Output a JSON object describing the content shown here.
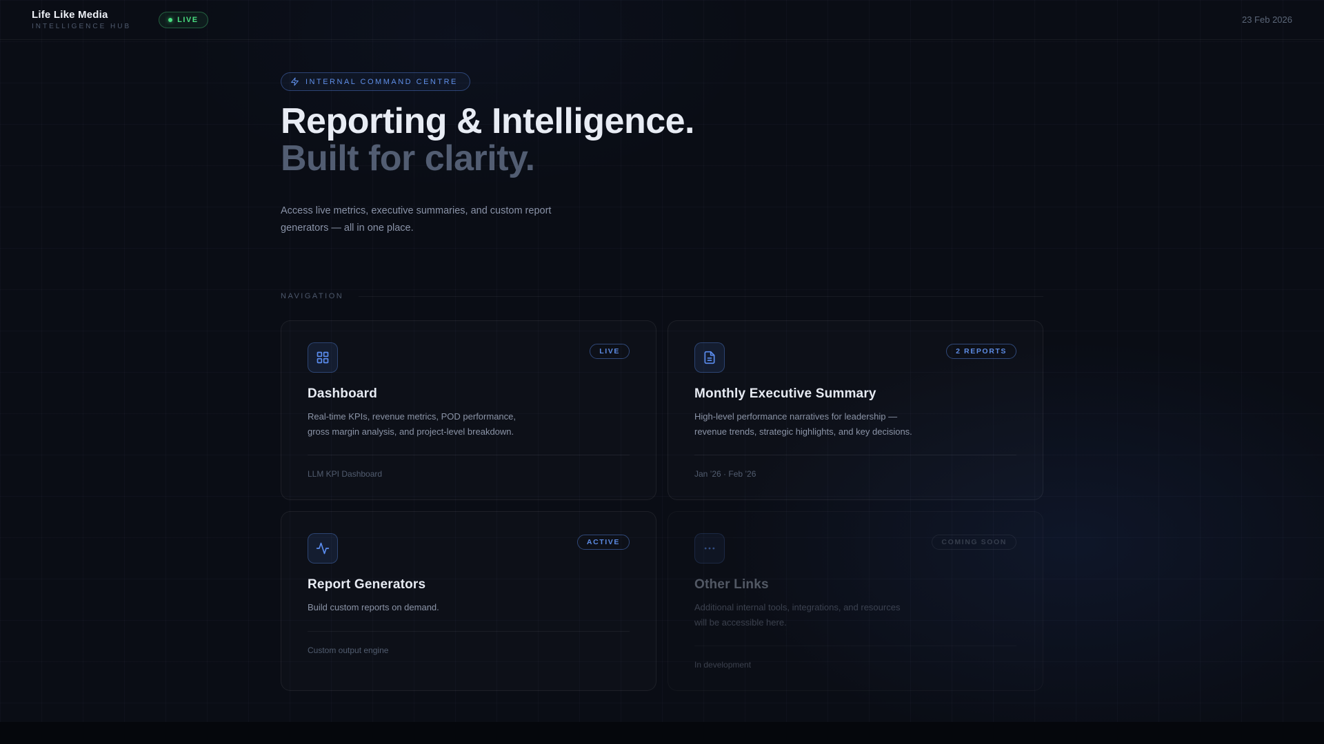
{
  "header": {
    "brand": "Life Like Media",
    "brand_sub": "INTELLIGENCE HUB",
    "live_badge": "LIVE",
    "date": "23 Feb 2026"
  },
  "hero": {
    "badge": "INTERNAL COMMAND CENTRE",
    "title_line1": "Reporting & Intelligence.",
    "title_line2": "Built for clarity.",
    "subtitle_line1": "Access live metrics, executive summaries, and custom report",
    "subtitle_line2": "generators — all in one place."
  },
  "nav": {
    "label": "NAVIGATION"
  },
  "cards": [
    {
      "icon": "grid-icon",
      "badge": "LIVE",
      "title": "Dashboard",
      "desc_lines": [
        "Real-time KPIs, revenue metrics, POD performance,",
        "gross margin analysis, and project-level breakdown."
      ],
      "footer": "LLM KPI Dashboard"
    },
    {
      "icon": "document-icon",
      "badge": "2 REPORTS",
      "title": "Monthly Executive Summary",
      "desc_lines": [
        "High-level performance narratives for leadership —",
        "revenue trends, strategic highlights, and key decisions."
      ],
      "footer": "Jan ’26 · Feb ’26"
    },
    {
      "icon": "activity-icon",
      "badge": "ACTIVE",
      "title": "Report Generators",
      "desc_lines": [
        "Build custom reports on demand."
      ],
      "footer": "Custom output engine"
    },
    {
      "icon": "ellipsis-icon",
      "badge": "COMING SOON",
      "title": "Other Links",
      "desc_lines": [
        "Additional internal tools, integrations, and resources",
        "will be accessible here."
      ],
      "footer": "In development",
      "disabled": true
    }
  ],
  "colors": {
    "background": "#0a0d15",
    "accent_blue": "#5b8def",
    "live_green": "#4ade80"
  }
}
